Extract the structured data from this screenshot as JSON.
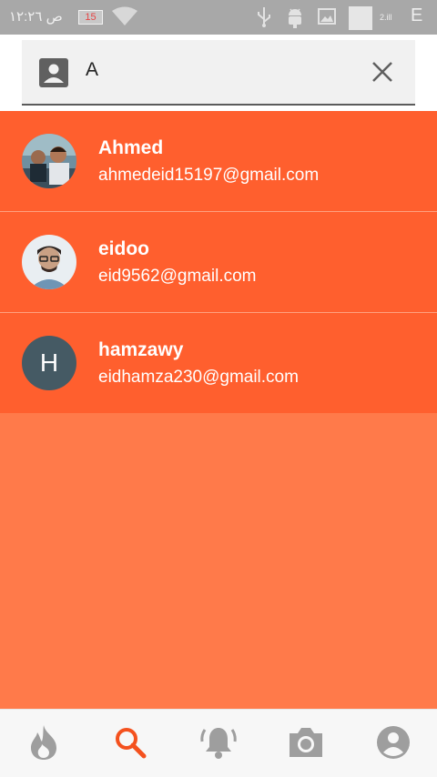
{
  "status_bar": {
    "time": "ص ١٢:٢٦",
    "badge": "15",
    "signal_text": "2.ill",
    "network": "E"
  },
  "search": {
    "value": "A",
    "placeholder": ""
  },
  "results": [
    {
      "name": "Ahmed",
      "email": "ahmedeid15197@gmail.com",
      "avatar": "photo"
    },
    {
      "name": "eidoo",
      "email": "eid9562@gmail.com",
      "avatar": "photo"
    },
    {
      "name": "hamzawy",
      "email": "eidhamza230@gmail.com",
      "avatar_letter": "H"
    }
  ],
  "bottom_nav": [
    {
      "icon": "flame-icon",
      "active": false
    },
    {
      "icon": "search-icon",
      "active": true
    },
    {
      "icon": "bell-icon",
      "active": false
    },
    {
      "icon": "camera-icon",
      "active": false
    },
    {
      "icon": "account-icon",
      "active": false
    }
  ],
  "colors": {
    "accent": "#ff5f2e",
    "background": "#ff7a4a",
    "active_nav": "#f4511e",
    "inactive_nav": "#9e9e9e",
    "status_bar": "#a8a8a8"
  }
}
